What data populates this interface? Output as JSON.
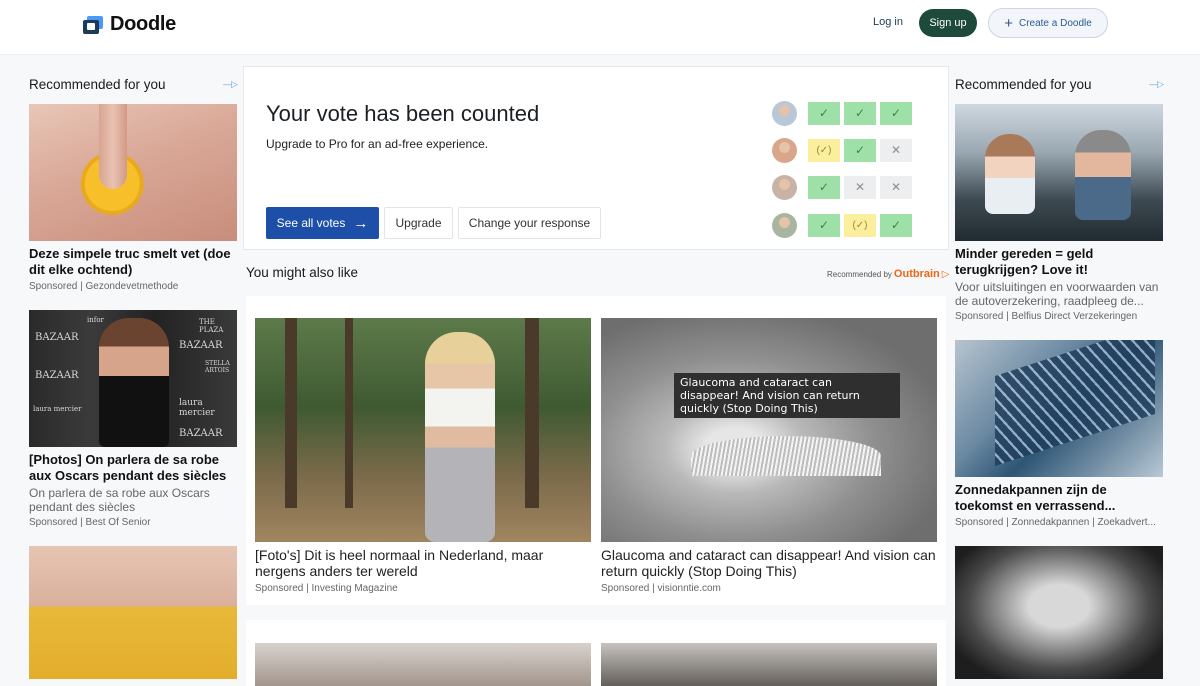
{
  "header": {
    "logo_text": "Doodle",
    "login": "Log in",
    "signup": "Sign up",
    "create": "Create a Doodle"
  },
  "colors": {
    "primary_button": "#1d4fa8",
    "signup_button": "#1d4a3a",
    "vote_yes": "#9fe0a8",
    "vote_maybe": "#fbef9e",
    "vote_no": "#eceef0",
    "outbrain_orange": "#ee6513"
  },
  "left_ads": {
    "title": "Recommended for you",
    "items": [
      {
        "title": "Deze simpele truc smelt vet (doe dit elke ochtend)",
        "desc": "",
        "sponsor": "Sponsored | Gezondevetmethode"
      },
      {
        "title": "[Photos] On parlera de sa robe aux Oscars pendant des siècles",
        "desc": "On parlera de sa robe aux Oscars pendant des siècles",
        "sponsor": "Sponsored | Best Of Senior"
      }
    ],
    "bazaar_texts": [
      "BAZAAR",
      "BAZAAR",
      "BAZAAR",
      "laura mercier",
      "laura mercier",
      "THE PLAZA",
      "STELLA ARTOIS",
      "BAZAAR",
      "infor"
    ]
  },
  "right_ads": {
    "title": "Recommended for you",
    "items": [
      {
        "title": "Minder gereden = geld terugkrijgen? Love it!",
        "desc": "Voor uitsluitingen en voorwaarden van de autoverzekering, raadpleeg de...",
        "sponsor": "Sponsored | Belfius Direct Verzekeringen"
      },
      {
        "title": "Zonnedakpannen zijn de toekomst en verrassend...",
        "desc": "",
        "sponsor": "Sponsored | Zonnedakpannen | Zoekadvert..."
      }
    ]
  },
  "vote": {
    "title": "Your vote has been counted",
    "subtitle": "Upgrade to Pro for an ad-free experience.",
    "see_all": "See all votes",
    "upgrade": "Upgrade",
    "change": "Change your response",
    "rows": [
      [
        "yes",
        "yes",
        "yes"
      ],
      [
        "maybe",
        "yes",
        "no"
      ],
      [
        "yes",
        "no",
        "no"
      ],
      [
        "yes",
        "maybe",
        "yes"
      ]
    ],
    "symbols": {
      "yes": "✓",
      "maybe": "(✓)",
      "no": "✕"
    }
  },
  "outbrain": {
    "heading": "You might also like",
    "recommended_by": "Recommended by",
    "brand": "Outbrain",
    "cards": [
      {
        "title": "[Foto's] Dit is heel normaal in Nederland, maar nergens anders ter wereld",
        "sponsor": "Sponsored | Investing Magazine"
      },
      {
        "title": "Glaucoma and cataract can disappear! And vision can return quickly (Stop Doing This)",
        "sponsor": "Sponsored | visionntie.com",
        "tooltip": "Glaucoma and cataract can disappear! And vision can return quickly (Stop Doing This)"
      }
    ]
  }
}
